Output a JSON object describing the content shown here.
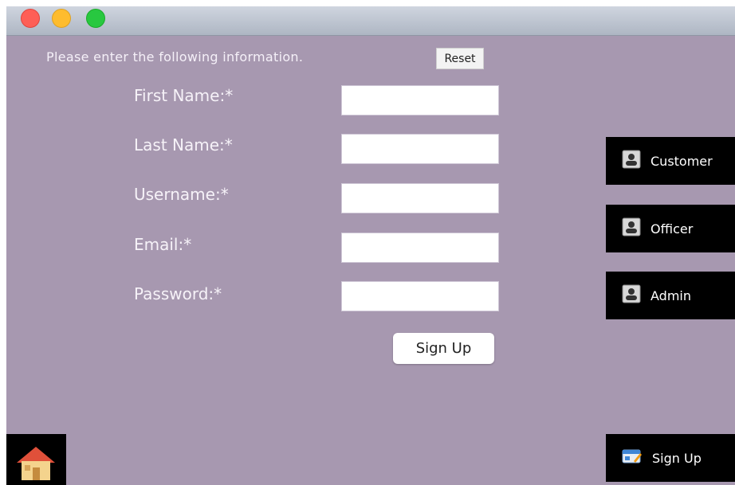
{
  "window": {
    "controls": [
      "close",
      "minimize",
      "zoom"
    ]
  },
  "form": {
    "instructions": "Please enter the following information.",
    "reset_label": "Reset",
    "fields": [
      {
        "label": "First Name:*",
        "value": ""
      },
      {
        "label": "Last Name:*",
        "value": ""
      },
      {
        "label": "Username:*",
        "value": ""
      },
      {
        "label": "Email:*",
        "value": ""
      },
      {
        "label": "Password:*",
        "value": ""
      }
    ],
    "submit_label": "Sign Up"
  },
  "sidebar": {
    "items": [
      {
        "label": "Customer",
        "icon": "person-icon"
      },
      {
        "label": "Officer",
        "icon": "person-icon"
      },
      {
        "label": "Admin",
        "icon": "person-icon"
      }
    ],
    "signup": {
      "label": "Sign Up",
      "icon": "signup-card-icon"
    }
  },
  "footer": {
    "home_icon": "house-icon"
  }
}
